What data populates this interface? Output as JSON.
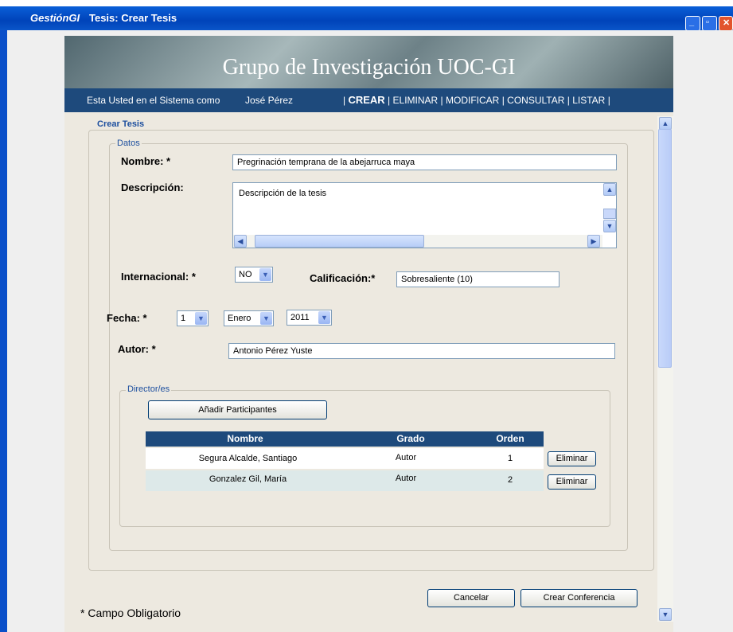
{
  "window": {
    "app_name": "GestiónGI",
    "title": "Tesis: Crear Tesis"
  },
  "header": {
    "title": "Grupo de Investigación UOC-GI"
  },
  "navbar": {
    "user_text": "Esta Usted en el Sistema como",
    "user_name": "José Pérez",
    "menu": {
      "sep": "|",
      "crear": "CREAR",
      "eliminar": "ELIMINAR",
      "modificar": "MODIFICAR",
      "consultar": "CONSULTAR",
      "listar": "LISTAR"
    }
  },
  "form": {
    "section_title": "Crear Tesis",
    "datos_legend": "Datos",
    "nombre_label": "Nombre: *",
    "nombre_value": "Pregrinación temprana de la abejarruca maya",
    "descripcion_label": "Descripción:",
    "descripcion_value": "Descripción de la tesis",
    "internacional_label": "Internacional: *",
    "internacional_value": "NO",
    "calificacion_label": "Calificación:*",
    "calificacion_value": "Sobresaliente (10)",
    "fecha_label": "Fecha: *",
    "fecha_day": "1",
    "fecha_month": "Enero",
    "fecha_year": "2011",
    "autor_label": "Autor: *",
    "autor_value": "Antonio Pérez Yuste"
  },
  "directores": {
    "legend": "Director/es",
    "add_button": "Añadir Participantes",
    "columns": [
      "Nombre",
      "Grado",
      "Orden"
    ],
    "rows": [
      {
        "nombre": "Segura Alcalde, Santiago",
        "grado": "Autor",
        "orden": "1",
        "action": "Eliminar"
      },
      {
        "nombre": "Gonzalez Gil, María",
        "grado": "Autor",
        "orden": "2",
        "action": "Eliminar"
      }
    ]
  },
  "footer": {
    "cancel_button": "Cancelar",
    "create_button": "Crear Conferencia",
    "required_note": "* Campo Obligatorio"
  },
  "icons": {
    "up": "▲",
    "down": "▼",
    "left": "◀",
    "right": "▶",
    "dropdown": "▼"
  },
  "colors": {
    "nav": "#1e4a7c",
    "titlebar": "#0043b9",
    "accent": "#1c4e9e"
  }
}
